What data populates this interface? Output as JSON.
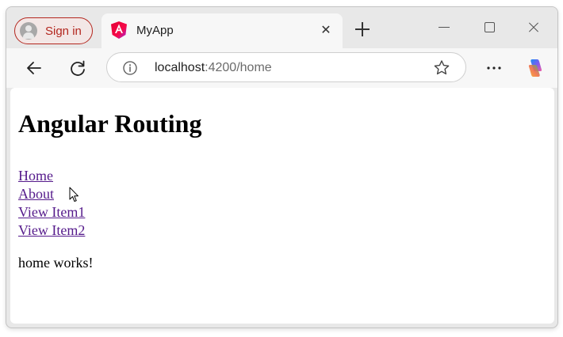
{
  "browser": {
    "signin_label": "Sign in",
    "tab": {
      "title": "MyApp"
    },
    "address": {
      "host": "localhost",
      "rest": ":4200/home"
    },
    "icons": {
      "avatar": "person-avatar-icon",
      "favicon": "angular-logo-icon",
      "tab_close": "close-icon",
      "new_tab": "plus-icon",
      "minimize": "minimize-icon",
      "maximize": "maximize-icon",
      "window_close": "close-icon",
      "back": "arrow-left-icon",
      "refresh": "refresh-icon",
      "info": "info-icon",
      "favorite": "star-icon",
      "more": "ellipsis-icon",
      "copilot": "copilot-icon"
    },
    "colors": {
      "signin_accent": "#b3261e",
      "link_visited": "#551a8b"
    }
  },
  "page": {
    "heading": "Angular Routing",
    "nav": [
      {
        "label": "Home"
      },
      {
        "label": "About"
      },
      {
        "label": "View Item1"
      },
      {
        "label": "View Item2"
      }
    ],
    "outlet_text": "home works!"
  }
}
